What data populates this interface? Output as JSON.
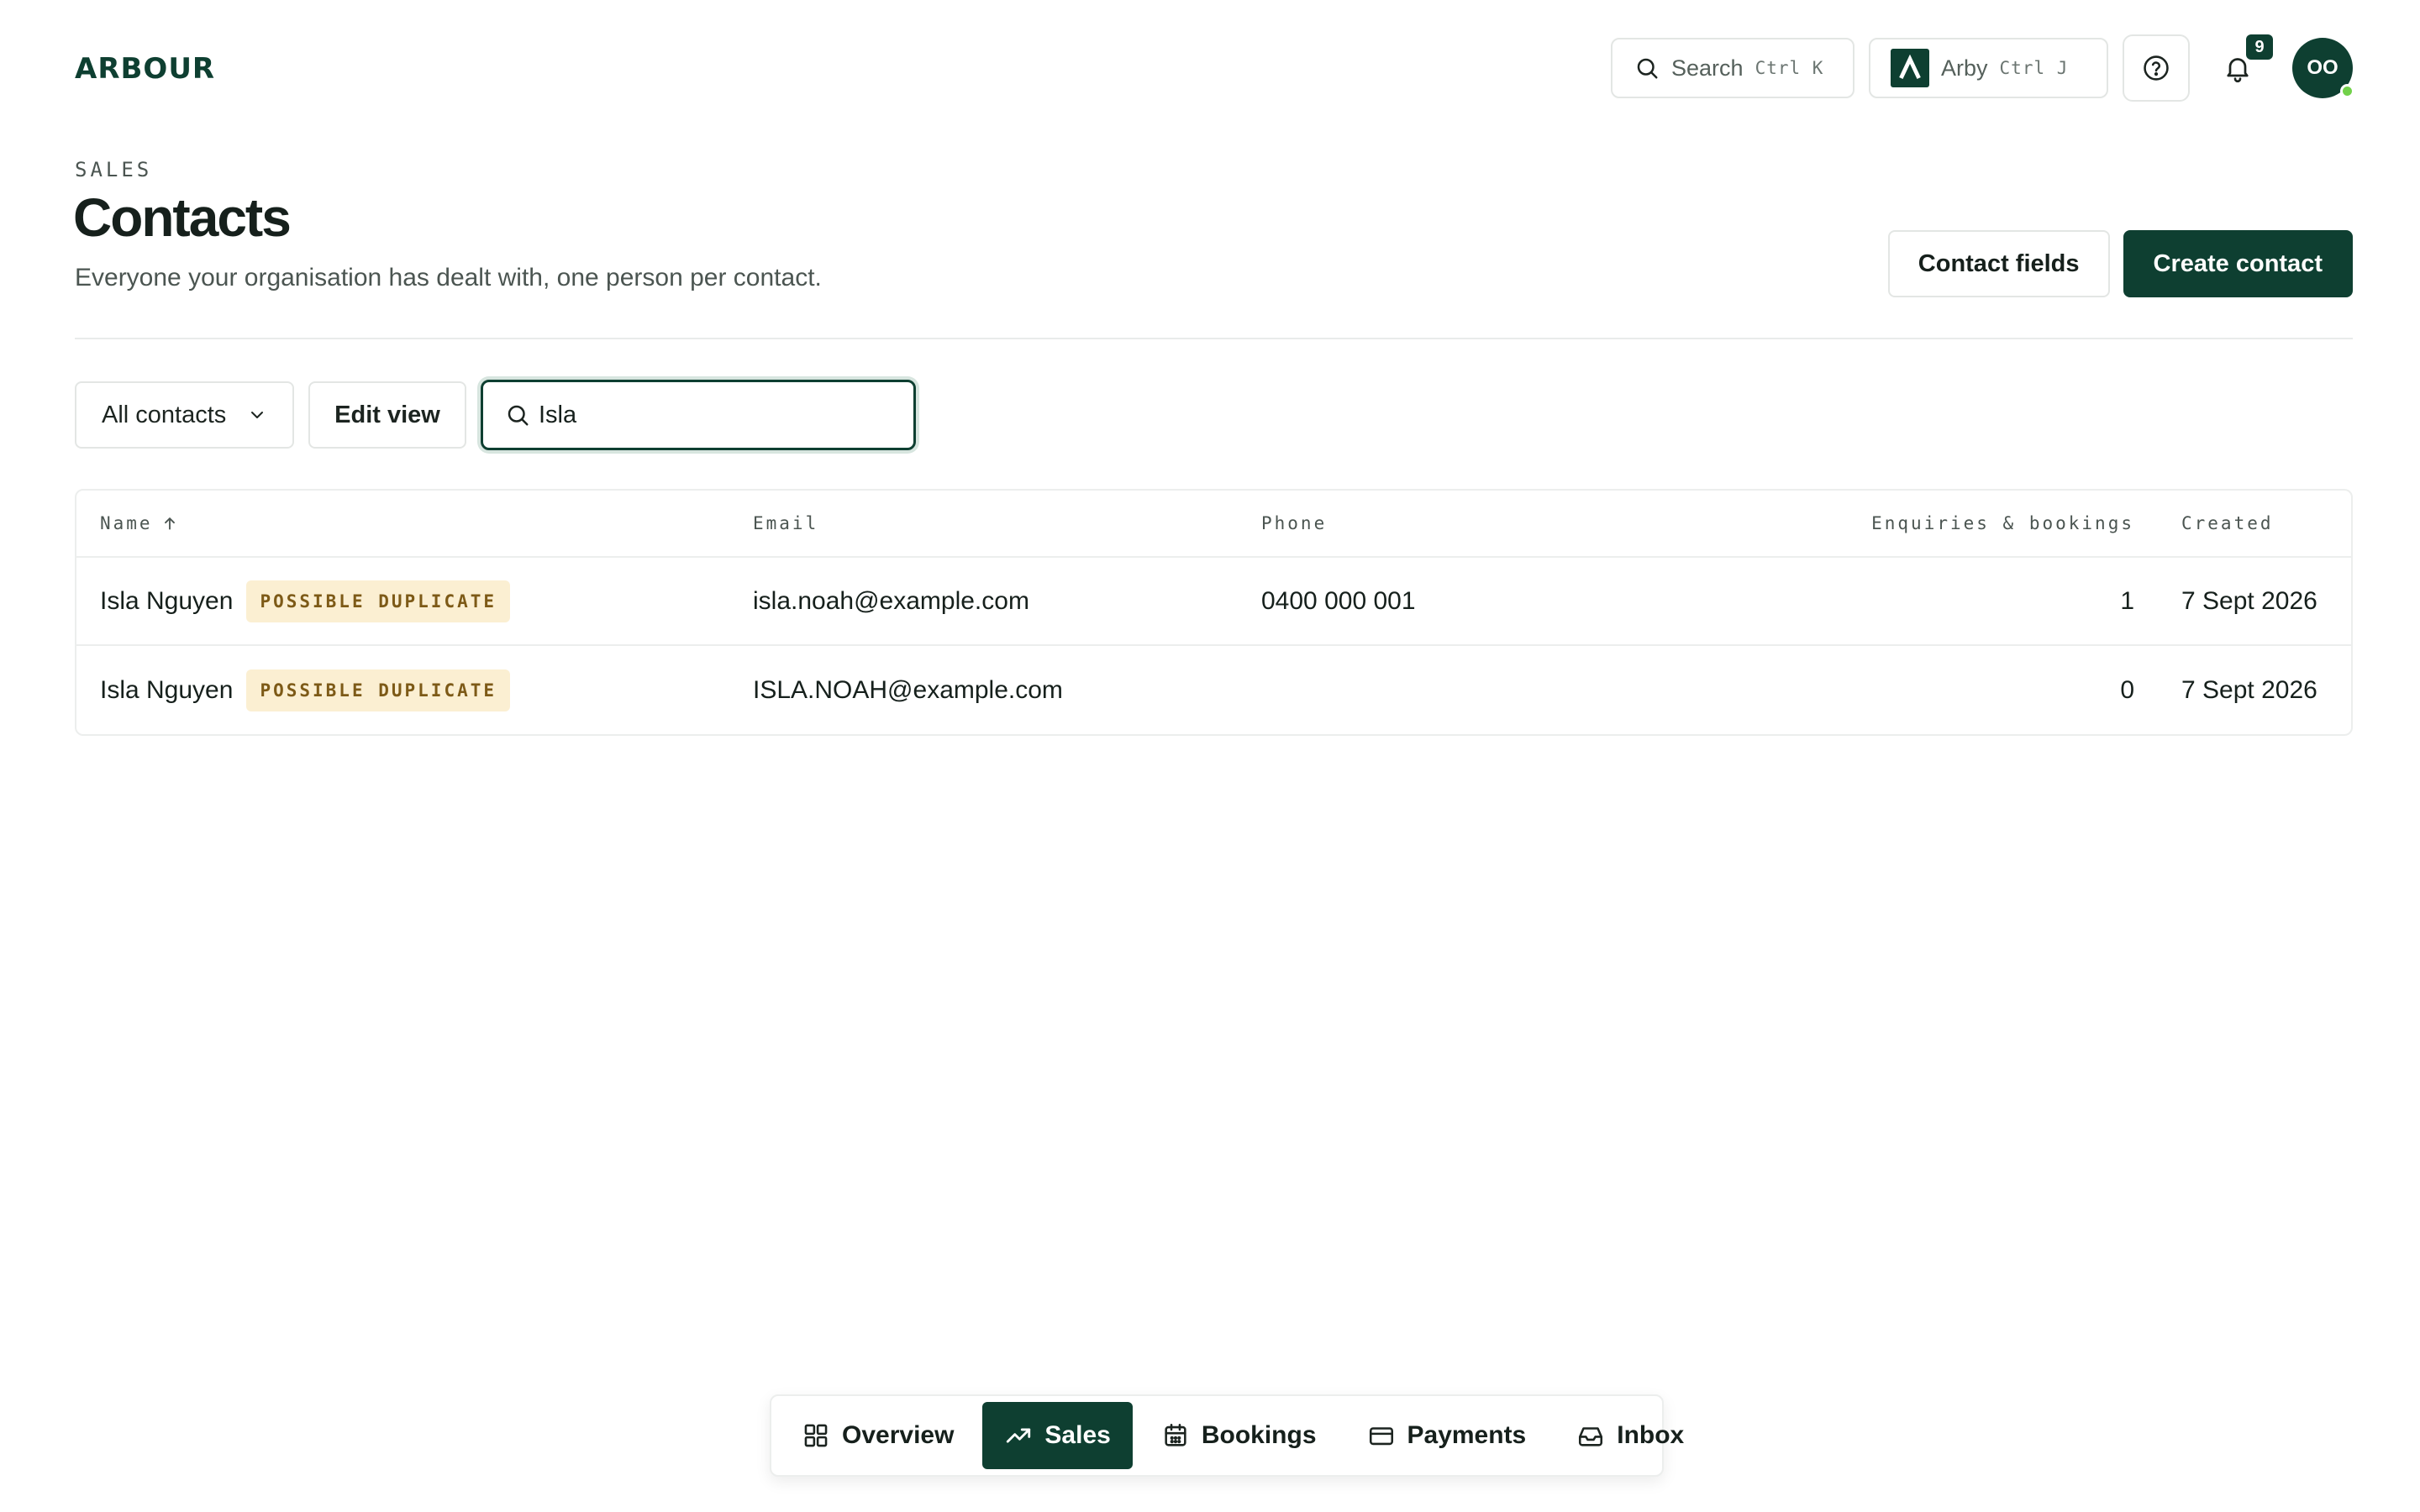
{
  "app": {
    "logo": "ARBOUR"
  },
  "topbar": {
    "search_label": "Search",
    "search_shortcut": "Ctrl K",
    "assistant_label": "Arby",
    "assistant_shortcut": "Ctrl J",
    "notification_count": "9",
    "avatar_initials": "OO"
  },
  "header": {
    "section": "SALES",
    "title": "Contacts",
    "subtitle": "Everyone your organisation has dealt with, one person per contact.",
    "contact_fields_label": "Contact fields",
    "create_contact_label": "Create contact"
  },
  "filters": {
    "view_selected": "All contacts",
    "edit_view_label": "Edit view",
    "search_value": "Isla"
  },
  "table": {
    "columns": {
      "name": "Name",
      "email": "Email",
      "phone": "Phone",
      "enquiries": "Enquiries & bookings",
      "created": "Created"
    },
    "rows": [
      {
        "name": "Isla Nguyen",
        "badge": "POSSIBLE DUPLICATE",
        "email": "isla.noah@example.com",
        "phone": "0400 000 001",
        "enquiries": "1",
        "created": "7 Sept 2026"
      },
      {
        "name": "Isla Nguyen",
        "badge": "POSSIBLE DUPLICATE",
        "email": "ISLA.NOAH@example.com",
        "phone": "",
        "enquiries": "0",
        "created": "7 Sept 2026"
      }
    ]
  },
  "bottom_nav": {
    "items": [
      {
        "label": "Overview",
        "icon": "grid-icon"
      },
      {
        "label": "Sales",
        "icon": "trending-up-icon",
        "active": true
      },
      {
        "label": "Bookings",
        "icon": "calendar-icon"
      },
      {
        "label": "Payments",
        "icon": "credit-card-icon"
      },
      {
        "label": "Inbox",
        "icon": "inbox-icon"
      }
    ]
  },
  "colors": {
    "brand": "#0e3f31",
    "badge_bg": "#fbefd2",
    "badge_text": "#7d5a17",
    "online": "#72d14a"
  }
}
